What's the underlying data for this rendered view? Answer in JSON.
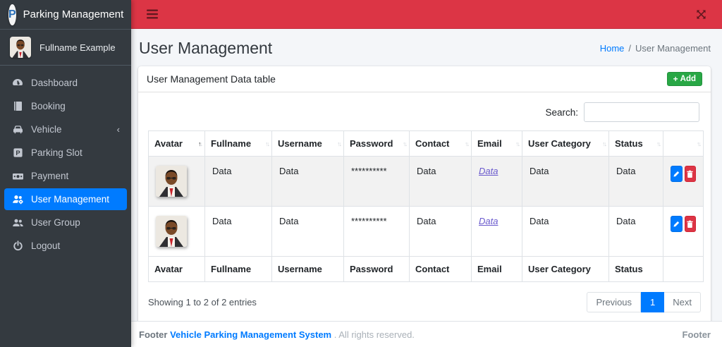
{
  "colors": {
    "navbar_red": "#dc3545",
    "sidebar_dark": "#343a40",
    "active_blue": "#007bff",
    "add_green": "#28a745",
    "delete_red": "#dc3545",
    "email_link": "#6a5acd"
  },
  "sidebar": {
    "brand": "Parking Management",
    "user_name": "Fullname Example",
    "items": [
      {
        "label": "Dashboard"
      },
      {
        "label": "Booking"
      },
      {
        "label": "Vehicle",
        "chevron": "‹"
      },
      {
        "label": "Parking Slot"
      },
      {
        "label": "Payment"
      },
      {
        "label": "User Management",
        "active": true
      },
      {
        "label": "User Group"
      },
      {
        "label": "Logout"
      }
    ]
  },
  "page": {
    "title": "User Management",
    "breadcrumb": {
      "home": "Home",
      "separator": "/",
      "current": "User Management"
    }
  },
  "card": {
    "header": "User Management Data table",
    "add_label": "Add",
    "add_plus": "+",
    "search_label": "Search:",
    "search_value": ""
  },
  "table": {
    "columns": [
      "Avatar",
      "Fullname",
      "Username",
      "Password",
      "Contact",
      "Email",
      "User Category",
      "Status",
      ""
    ],
    "sort": {
      "column": "Avatar",
      "direction": "asc"
    },
    "rows": [
      {
        "fullname": "Data",
        "username": "Data",
        "password": "**********",
        "contact": "Data",
        "email": "Data",
        "category": "Data",
        "status": "Data"
      },
      {
        "fullname": "Data",
        "username": "Data",
        "password": "**********",
        "contact": "Data",
        "email": "Data",
        "category": "Data",
        "status": "Data"
      }
    ],
    "footer_columns": [
      "Avatar",
      "Fullname",
      "Username",
      "Password",
      "Contact",
      "Email",
      "User Category",
      "Status",
      ""
    ],
    "info": "Showing 1 to 2 of 2 entries",
    "pagination": {
      "previous": "Previous",
      "page": "1",
      "next": "Next"
    }
  },
  "footer": {
    "left_prefix": "Footer",
    "link": "Vehicle Parking Management System",
    "left_suffix": ". All rights reserved.",
    "right": "Footer"
  }
}
